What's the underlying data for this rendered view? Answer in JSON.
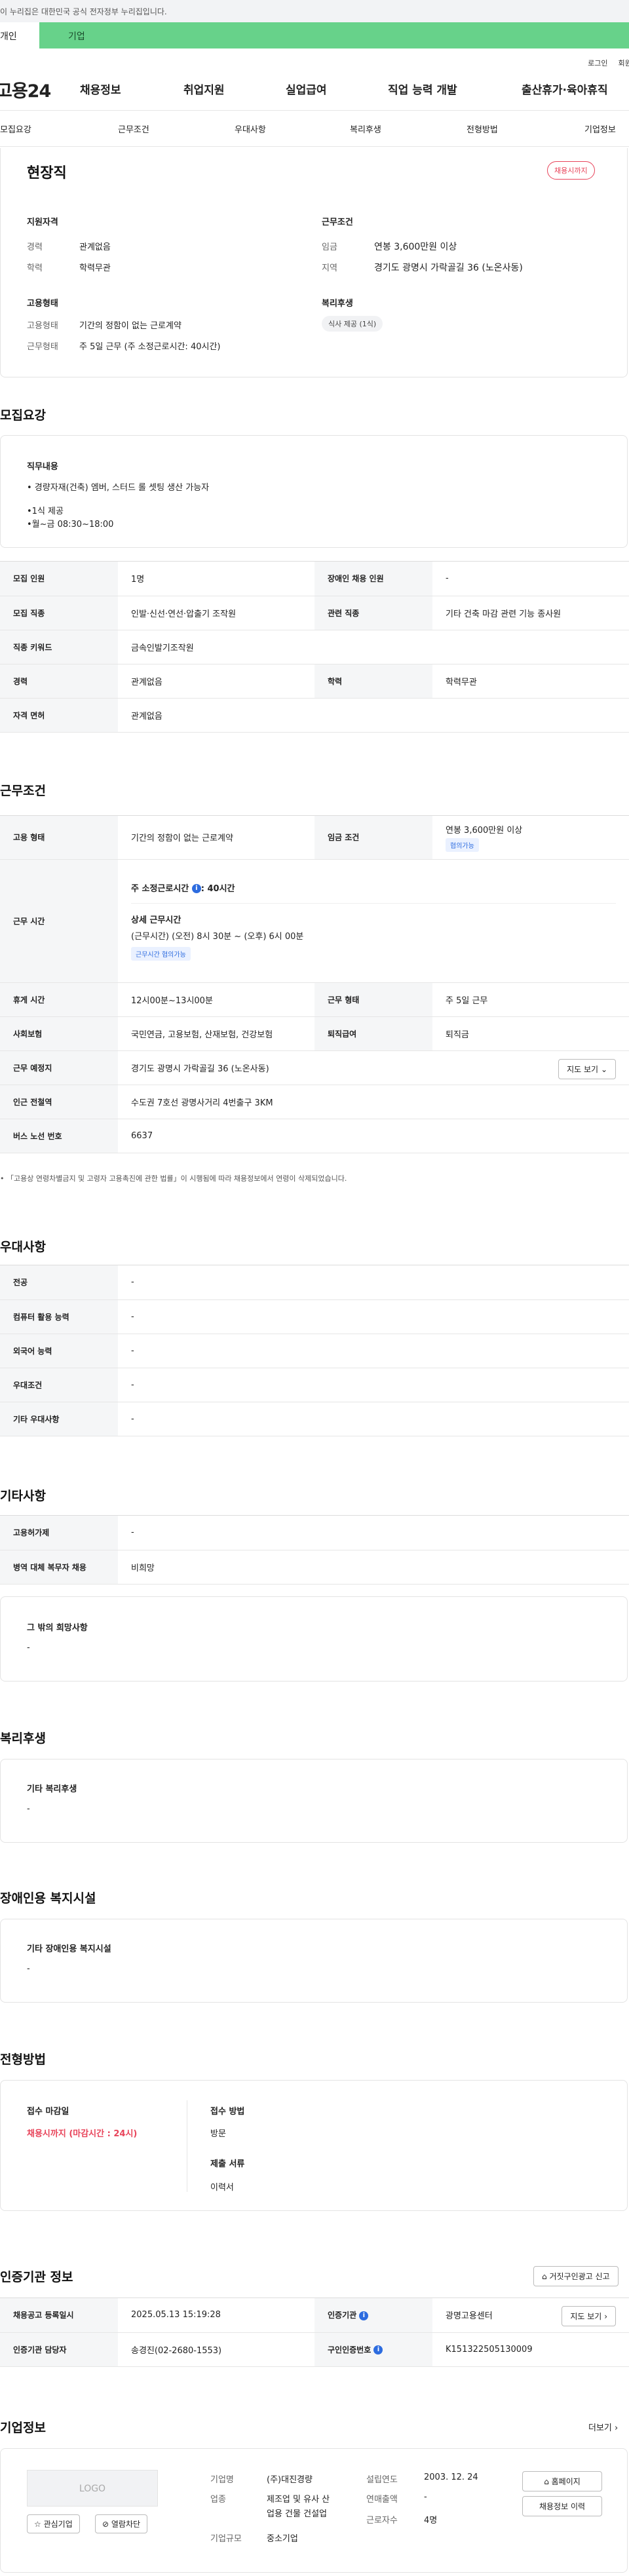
{
  "banner": {
    "text": "이 누리집은 대한민국 공식 전자정부 누리집입니다."
  },
  "persona": {
    "individual": "개인",
    "company": "기업"
  },
  "util": {
    "login": "로그인",
    "join": "회원가입"
  },
  "gnb": {
    "logo": "고용24",
    "menu": [
      "채용정보",
      "취업지원",
      "실업급여",
      "직업 능력 개발",
      "출산휴가·육아휴직"
    ]
  },
  "tabs": [
    "모집요강",
    "근무조건",
    "우대사항",
    "복리후생",
    "전형방법",
    "기업정보"
  ],
  "summary": {
    "title": "현장직",
    "deadline_badge": "채용시까지",
    "qual_h": "지원자격",
    "career_l": "경력",
    "career_v": "관계없음",
    "edu_l": "학력",
    "edu_v": "학력무관",
    "cond_h": "근무조건",
    "wage_l": "임금",
    "wage_v": "연봉 3,600만원 이상",
    "area_l": "지역",
    "area_v": "경기도 광명시 가락골길 36 (노온사동)",
    "emp_h": "고용형태",
    "emp_l": "고용형태",
    "emp_v": "기간의 정함이 없는 근로계약",
    "work_l": "근무형태",
    "work_v": "주 5일 근무 (주 소정근로시간: 40시간)",
    "welfare_h": "복리후생",
    "welfare_chip": "식사 제공 (1식)"
  },
  "recruit": {
    "h": "모집요강",
    "duty_h": "직무내용",
    "duty_1": "• 경량자재(건축) 엠버, 스터드 롤 셋팅 생산 가능자",
    "duty_2": "•1식 제공",
    "duty_3": "•월~금 08:30~18:00",
    "rows": [
      {
        "l1": "모집 인원",
        "v1": "1명",
        "l2": "장애인 채용 인원",
        "v2": "-"
      },
      {
        "l1": "모집 직종",
        "v1": "인발·신선·연선·압출기 조작원",
        "l2": "관련 직종",
        "v2": "기타 건축 마감 관련 기능 종사원"
      },
      {
        "l1": "직종 키워드",
        "v1": "금속인발기조작원"
      },
      {
        "l1": "경력",
        "v1": "관계없음",
        "l2": "학력",
        "v2": "학력무관"
      },
      {
        "l1": "자격 면허",
        "v1": "관계없음"
      }
    ]
  },
  "work": {
    "h": "근무조건",
    "emp_l": "고용 형태",
    "emp_v": "기간의 정함이 없는 근로계약",
    "wage_l": "임금 조건",
    "wage_v": "연봉 3,600만원 이상",
    "wage_chip": "협의가능",
    "time_l": "근무 시간",
    "time_weekly": "주 소정근로시간",
    "time_weekly_v": ": 40시간",
    "time_detail_h": "상세 근무시간",
    "time_detail_v": "(근무시간) (오전) 8시 30분 ~ (오후) 6시 00분",
    "time_chip": "근무시간 협의가능",
    "rest_l": "휴게 시간",
    "rest_v": "12시00분~13시00분",
    "type_l": "근무 형태",
    "type_v": "주 5일 근무",
    "ins_l": "사회보험",
    "ins_v": "국민연금, 고용보험, 산재보험, 건강보험",
    "sev_l": "퇴직급여",
    "sev_v": "퇴직금",
    "place_l": "근무 예정지",
    "place_v": "경기도 광명시 가락골길 36 (노온사동)",
    "map_btn": "지도 보기",
    "station_l": "인근 전철역",
    "station_v": "수도권 7호선 광명사거리 4번출구 3KM",
    "bus_l": "버스 노선 번호",
    "bus_v": "6637",
    "note": "• 「고용상 연령차별금지 및 고령자 고용촉진에 관한 법률」이 시행됨에 따라 채용정보에서 연령이 삭제되었습니다."
  },
  "pref": {
    "h": "우대사항",
    "rows": [
      {
        "l": "전공",
        "v": "-"
      },
      {
        "l": "컴퓨터 활용 능력",
        "v": "-"
      },
      {
        "l": "외국어 능력",
        "v": "-"
      },
      {
        "l": "우대조건",
        "v": "-"
      },
      {
        "l": "기타 우대사항",
        "v": "-"
      }
    ]
  },
  "etc": {
    "h": "기타사항",
    "rows": [
      {
        "l": "고용허가제",
        "v": "-"
      },
      {
        "l": "병역 대체 복무자 채용",
        "v": "비희망"
      }
    ],
    "other_h": "그 밖의 희망사항",
    "other_v": "-"
  },
  "welfare": {
    "h": "복리후생",
    "box_h": "기타 복리후생",
    "box_v": "-"
  },
  "disab": {
    "h": "장애인용 복지시설",
    "box_h": "기타 장애인용 복지시설",
    "box_v": "-"
  },
  "process": {
    "h": "전형방법",
    "deadline_h": "접수 마감일",
    "deadline_v": "채용시까지 (마감시간 : 24시)",
    "method_h": "접수 방법",
    "method_v": "방문",
    "docs_h": "제출 서류",
    "docs_v": "이력서"
  },
  "cert": {
    "h": "인증기관 정보",
    "report_btn": "거짓구인광고 신고",
    "reg_l": "채용공고 등록일시",
    "reg_v": "2025.05.13 15:19:28",
    "agency_l": "인증기관",
    "agency_v": "광명고용센터",
    "map_btn": "지도 보기",
    "staff_l": "인증기관 담당자",
    "staff_v": "송경진(02-2680-1553)",
    "num_l": "구인인증번호",
    "num_v": "K151322505130009"
  },
  "company": {
    "h": "기업정보",
    "more": "더보기",
    "logo": "LOGO",
    "fav": "관심기업",
    "block": "열람차단",
    "name_l": "기업명",
    "name_v": "(주)대진경량",
    "ind_l": "업종",
    "ind_v1": "제조업 및 유사 산",
    "ind_v2": "업용 건물 건설업",
    "size_l": "기업규모",
    "size_v": "중소기업",
    "est_l": "설립연도",
    "est_v": "2003. 12. 24",
    "sales_l": "연매출액",
    "sales_v": "-",
    "emp_l": "근로자수",
    "emp_v": "4명",
    "home_btn": "홈페이지",
    "hist_btn": "채용정보 이력"
  }
}
